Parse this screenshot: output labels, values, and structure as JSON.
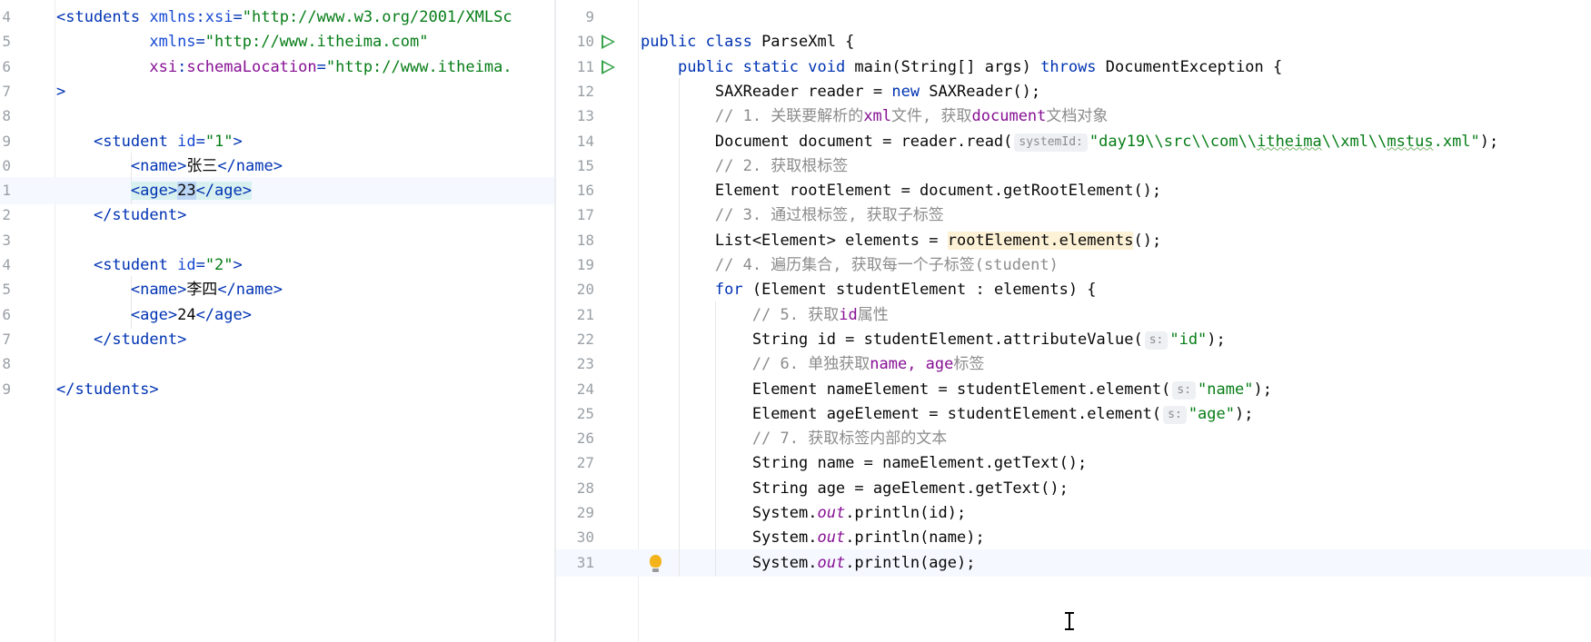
{
  "left_editor": {
    "lines": [
      {
        "n": "4",
        "parts": [
          [
            "tag",
            "<students "
          ],
          [
            "attr",
            "xmlns"
          ],
          [
            "tag",
            ":"
          ],
          [
            "attr",
            "xsi"
          ],
          [
            "tag",
            "="
          ],
          [
            "str",
            "\"http://www.w3.org/2001/XMLSc"
          ]
        ]
      },
      {
        "n": "5",
        "parts": [
          [
            "plain",
            "          "
          ],
          [
            "attr",
            "xmlns"
          ],
          [
            "tag",
            "="
          ],
          [
            "str",
            "\"http://www.itheima.com\""
          ]
        ]
      },
      {
        "n": "6",
        "parts": [
          [
            "plain",
            "          "
          ],
          [
            "aname",
            "xsi"
          ],
          [
            "tag",
            ":"
          ],
          [
            "aname",
            "schemaLocation"
          ],
          [
            "tag",
            "="
          ],
          [
            "str",
            "\"http://www.itheima."
          ]
        ]
      },
      {
        "n": "7",
        "parts": [
          [
            "tag",
            ">"
          ]
        ]
      },
      {
        "n": "8",
        "parts": []
      },
      {
        "n": "9",
        "parts": [
          [
            "plain",
            "    "
          ],
          [
            "tag",
            "<student "
          ],
          [
            "attr",
            "id"
          ],
          [
            "tag",
            "="
          ],
          [
            "str",
            "\"1\""
          ],
          [
            "tag",
            ">"
          ]
        ]
      },
      {
        "n": "0",
        "parts": [
          [
            "plain",
            "        "
          ],
          [
            "tag",
            "<name>"
          ],
          [
            "plain",
            "张三"
          ],
          [
            "tag",
            "</name>"
          ]
        ]
      },
      {
        "n": "1",
        "current": true,
        "parts": [
          [
            "plain",
            "        "
          ],
          [
            "tag hl-tag",
            "<age>"
          ],
          [
            "plain hl-sel",
            "23"
          ],
          [
            "tag hl-tag",
            "</age>"
          ]
        ]
      },
      {
        "n": "2",
        "parts": [
          [
            "plain",
            "    "
          ],
          [
            "tag",
            "</student>"
          ]
        ]
      },
      {
        "n": "3",
        "parts": []
      },
      {
        "n": "4",
        "parts": [
          [
            "plain",
            "    "
          ],
          [
            "tag",
            "<student "
          ],
          [
            "attr",
            "id"
          ],
          [
            "tag",
            "="
          ],
          [
            "str",
            "\"2\""
          ],
          [
            "tag",
            ">"
          ]
        ]
      },
      {
        "n": "5",
        "parts": [
          [
            "plain",
            "        "
          ],
          [
            "tag",
            "<name>"
          ],
          [
            "plain",
            "李四"
          ],
          [
            "tag",
            "</name>"
          ]
        ]
      },
      {
        "n": "6",
        "parts": [
          [
            "plain",
            "        "
          ],
          [
            "tag",
            "<age>"
          ],
          [
            "plain",
            "24"
          ],
          [
            "tag",
            "</age>"
          ]
        ]
      },
      {
        "n": "7",
        "parts": [
          [
            "plain",
            "    "
          ],
          [
            "tag",
            "</student>"
          ]
        ]
      },
      {
        "n": "8",
        "parts": []
      },
      {
        "n": "9",
        "parts": [
          [
            "tag",
            "</students>"
          ]
        ]
      }
    ]
  },
  "right_editor": {
    "lines": [
      {
        "n": "9",
        "parts": []
      },
      {
        "n": "10",
        "run": true,
        "parts": [
          [
            "kw",
            "public class "
          ],
          [
            "plain",
            "ParseXml {"
          ]
        ]
      },
      {
        "n": "11",
        "run": true,
        "parts": [
          [
            "plain",
            "    "
          ],
          [
            "kw",
            "public static void "
          ],
          [
            "plain",
            "main(String[] args) "
          ],
          [
            "kw",
            "throws "
          ],
          [
            "plain",
            "DocumentException {"
          ]
        ]
      },
      {
        "n": "12",
        "parts": [
          [
            "plain",
            "        SAXReader reader = "
          ],
          [
            "kw",
            "new "
          ],
          [
            "plain",
            "SAXReader();"
          ]
        ]
      },
      {
        "n": "13",
        "parts": [
          [
            "plain",
            "        "
          ],
          [
            "cm",
            "// 1. 关联要解析的"
          ],
          [
            "cm-kw",
            "xml"
          ],
          [
            "cm",
            "文件, 获取"
          ],
          [
            "cm-kw",
            "document"
          ],
          [
            "cm",
            "文档对象"
          ]
        ]
      },
      {
        "n": "14",
        "parts": [
          [
            "plain",
            "        Document document = reader.read("
          ],
          [
            "hint",
            "systemId:"
          ],
          [
            "str",
            "\"day19\\\\src\\\\com\\\\"
          ],
          [
            "str squig",
            "itheima"
          ],
          [
            "str",
            "\\\\xml\\\\"
          ],
          [
            "str squig",
            "mstus"
          ],
          [
            "str",
            ".xml\""
          ],
          [
            "plain",
            ");"
          ]
        ]
      },
      {
        "n": "15",
        "parts": [
          [
            "plain",
            "        "
          ],
          [
            "cm",
            "// 2. 获取根标签"
          ]
        ]
      },
      {
        "n": "16",
        "parts": [
          [
            "plain",
            "        Element rootElement = document.getRootElement();"
          ]
        ]
      },
      {
        "n": "17",
        "parts": [
          [
            "plain",
            "        "
          ],
          [
            "cm",
            "// 3. 通过根标签, 获取子标签"
          ]
        ]
      },
      {
        "n": "18",
        "parts": [
          [
            "plain",
            "        List<Element> elements = "
          ],
          [
            "plain hl-yellow",
            "rootElement.elements"
          ],
          [
            "plain",
            "();"
          ]
        ]
      },
      {
        "n": "19",
        "parts": [
          [
            "plain",
            "        "
          ],
          [
            "cm",
            "// 4. 遍历集合, 获取每一个子标签(student)"
          ]
        ]
      },
      {
        "n": "20",
        "parts": [
          [
            "plain",
            "        "
          ],
          [
            "kw",
            "for "
          ],
          [
            "plain",
            "(Element studentElement : elements) {"
          ]
        ]
      },
      {
        "n": "21",
        "parts": [
          [
            "plain",
            "            "
          ],
          [
            "cm",
            "// 5. 获取"
          ],
          [
            "cm-kw",
            "id"
          ],
          [
            "cm",
            "属性"
          ]
        ]
      },
      {
        "n": "22",
        "parts": [
          [
            "plain",
            "            String id = studentElement.attributeValue("
          ],
          [
            "hint",
            "s:"
          ],
          [
            "str",
            "\"id\""
          ],
          [
            "plain",
            ");"
          ]
        ]
      },
      {
        "n": "23",
        "parts": [
          [
            "plain",
            "            "
          ],
          [
            "cm",
            "// 6. 单独获取"
          ],
          [
            "cm-kw",
            "name, age"
          ],
          [
            "cm",
            "标签"
          ]
        ]
      },
      {
        "n": "24",
        "parts": [
          [
            "plain",
            "            Element nameElement = studentElement.element("
          ],
          [
            "hint",
            "s:"
          ],
          [
            "str",
            "\"name\""
          ],
          [
            "plain",
            ");"
          ]
        ]
      },
      {
        "n": "25",
        "parts": [
          [
            "plain",
            "            Element ageElement = studentElement.element("
          ],
          [
            "hint",
            "s:"
          ],
          [
            "str",
            "\"age\""
          ],
          [
            "plain",
            ");"
          ]
        ]
      },
      {
        "n": "26",
        "parts": [
          [
            "plain",
            "            "
          ],
          [
            "cm",
            "// 7. 获取标签内部的文本"
          ]
        ]
      },
      {
        "n": "27",
        "parts": [
          [
            "plain",
            "            String name = nameElement.getText();"
          ]
        ]
      },
      {
        "n": "28",
        "parts": [
          [
            "plain",
            "            String age = ageElement.getText();"
          ]
        ]
      },
      {
        "n": "29",
        "parts": [
          [
            "plain",
            "            System."
          ],
          [
            "static",
            "out"
          ],
          [
            "plain",
            ".println(id);"
          ]
        ]
      },
      {
        "n": "30",
        "parts": [
          [
            "plain",
            "            System."
          ],
          [
            "static",
            "out"
          ],
          [
            "plain",
            ".println(name);"
          ]
        ]
      },
      {
        "n": "31",
        "current": true,
        "bulb": true,
        "parts": [
          [
            "plain",
            "            System."
          ],
          [
            "static",
            "out"
          ],
          [
            "plain",
            ".println(age);"
          ]
        ]
      }
    ]
  }
}
